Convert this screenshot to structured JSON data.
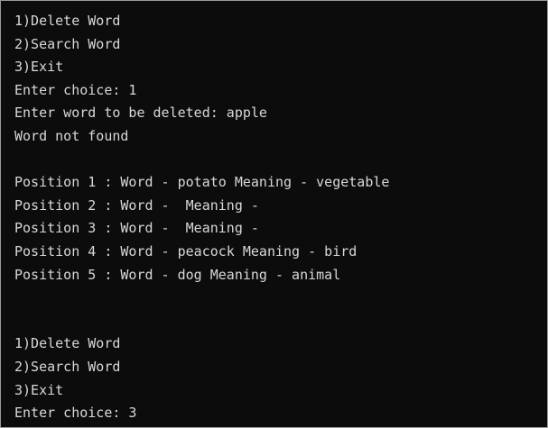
{
  "console": {
    "lines": [
      "1)Delete Word",
      "2)Search Word",
      "3)Exit",
      "Enter choice: 1",
      "Enter word to be deleted: apple",
      "Word not found",
      "",
      "Position 1 : Word - potato Meaning - vegetable",
      "Position 2 : Word -  Meaning -",
      "Position 3 : Word -  Meaning -",
      "Position 4 : Word - peacock Meaning - bird",
      "Position 5 : Word - dog Meaning - animal",
      "",
      "",
      "1)Delete Word",
      "2)Search Word",
      "3)Exit",
      "Enter choice: 3"
    ]
  }
}
